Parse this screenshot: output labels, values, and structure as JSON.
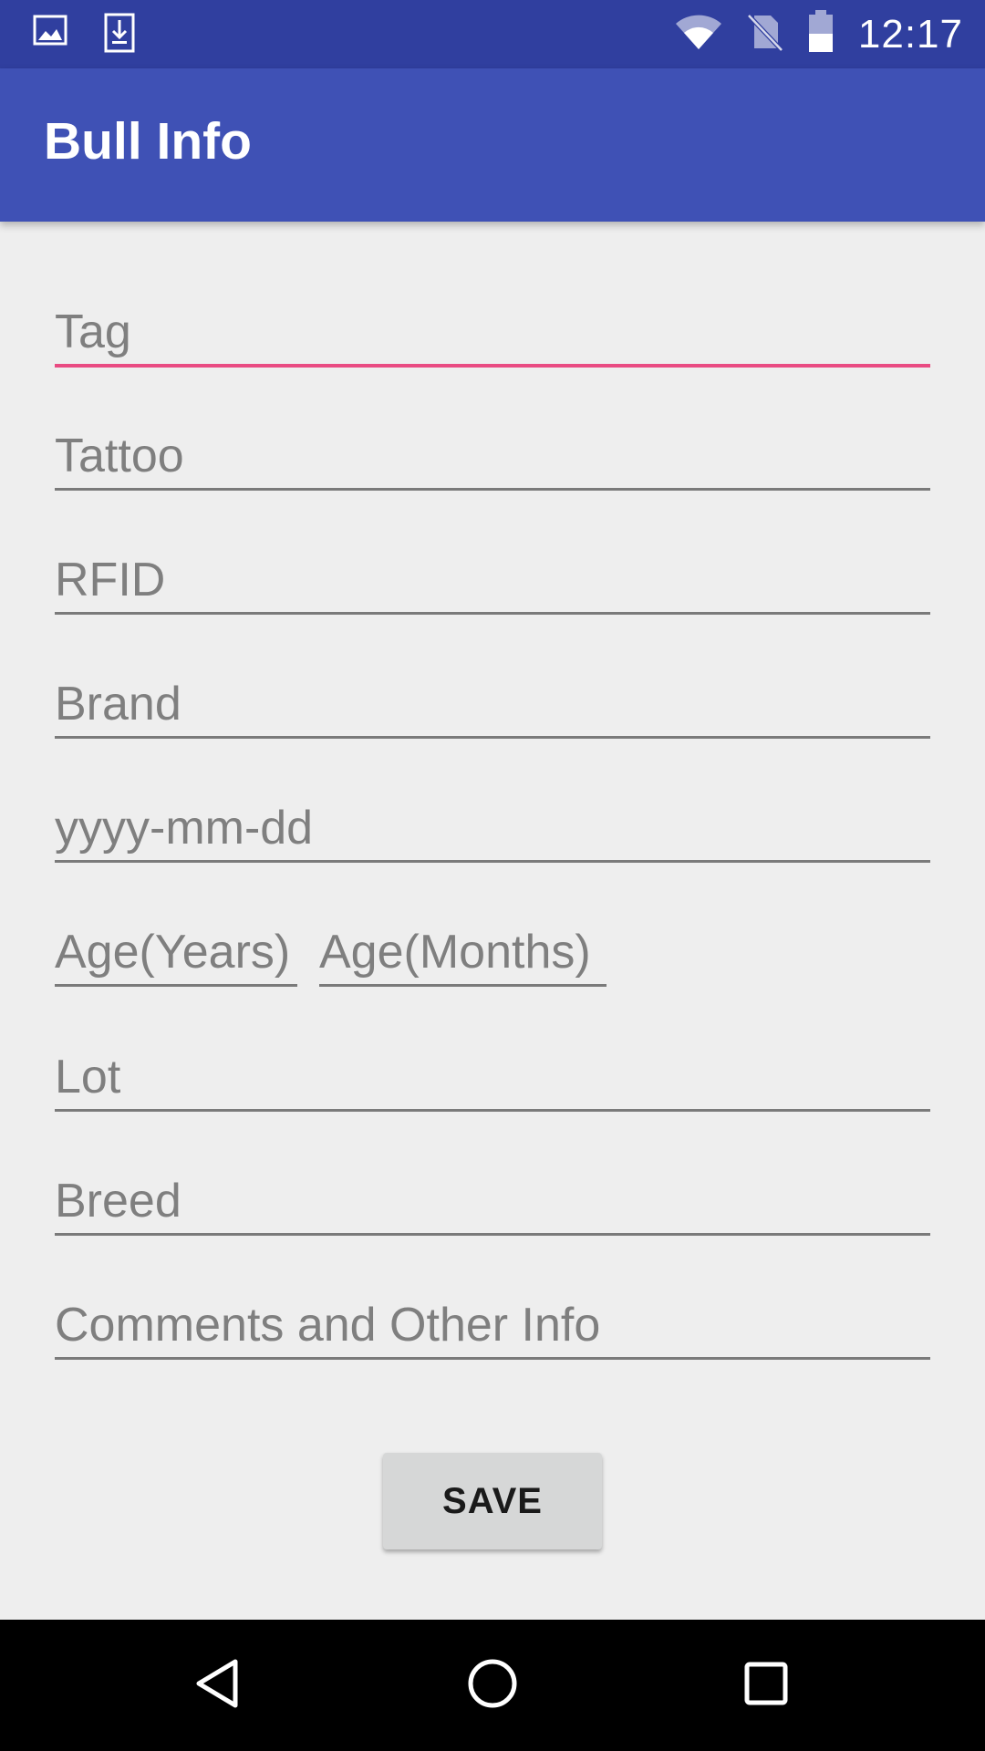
{
  "status_bar": {
    "time": "12:17",
    "icons": [
      "gallery-icon",
      "download-icon",
      "wifi-icon",
      "no-sim-icon",
      "battery-icon"
    ]
  },
  "app_bar": {
    "title": "Bull Info"
  },
  "form": {
    "tag": {
      "value": "",
      "placeholder": "Tag"
    },
    "tattoo": {
      "value": "",
      "placeholder": "Tattoo"
    },
    "rfid": {
      "value": "",
      "placeholder": "RFID"
    },
    "brand": {
      "value": "",
      "placeholder": "Brand"
    },
    "date": {
      "value": "",
      "placeholder": "yyyy-mm-dd"
    },
    "age_years": {
      "value": "",
      "placeholder": "Age(Years)"
    },
    "age_months": {
      "value": "",
      "placeholder": "Age(Months)"
    },
    "lot": {
      "value": "",
      "placeholder": "Lot"
    },
    "breed": {
      "value": "",
      "placeholder": "Breed"
    },
    "comments": {
      "value": "",
      "placeholder": "Comments and Other Info"
    },
    "save_label": "SAVE"
  },
  "nav_bar": {
    "icons": [
      "back-icon",
      "home-icon",
      "recents-icon"
    ]
  },
  "colors": {
    "status_bar": "#303f9f",
    "app_bar": "#3f51b5",
    "accent": "#e94b82",
    "background": "#eeeeee"
  }
}
